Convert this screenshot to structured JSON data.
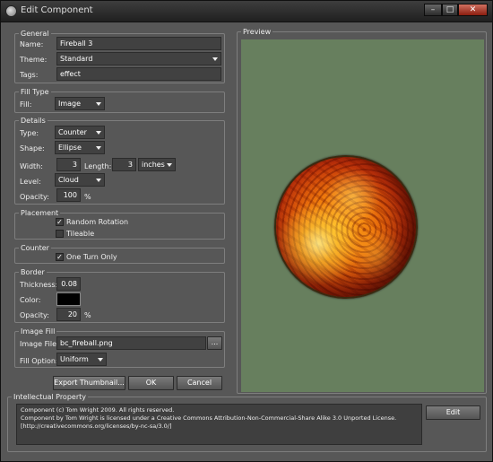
{
  "window": {
    "title": "Edit Component",
    "controls": {
      "minimize": "–",
      "maximize": "□",
      "close": "✕"
    }
  },
  "general": {
    "title": "General",
    "name_label": "Name:",
    "name_value": "Fireball 3",
    "theme_label": "Theme:",
    "theme_value": "Standard",
    "tags_label": "Tags:",
    "tags_value": "effect"
  },
  "fill_type": {
    "title": "Fill Type",
    "fill_label": "Fill:",
    "fill_value": "Image"
  },
  "details": {
    "title": "Details",
    "type_label": "Type:",
    "type_value": "Counter",
    "shape_label": "Shape:",
    "shape_value": "Ellipse",
    "width_label": "Width:",
    "width_value": "3",
    "length_label": "Length:",
    "length_value": "3",
    "unit_value": "inches",
    "level_label": "Level:",
    "level_value": "Cloud",
    "opacity_label": "Opacity:",
    "opacity_value": "100",
    "percent": "%"
  },
  "placement": {
    "title": "Placement",
    "random_rotation_label": "Random Rotation",
    "random_rotation_checked": true,
    "tileable_label": "Tileable",
    "tileable_checked": false
  },
  "counter": {
    "title": "Counter",
    "one_turn_label": "One Turn Only",
    "one_turn_checked": true
  },
  "border": {
    "title": "Border",
    "thickness_label": "Thickness:",
    "thickness_value": "0.08",
    "color_label": "Color:",
    "color_value": "#000000",
    "opacity_label": "Opacity:",
    "opacity_value": "20",
    "percent": "%"
  },
  "image_fill": {
    "title": "Image Fill",
    "file_label": "Image File:",
    "file_value": "bc_fireball.png",
    "browse_label": "...",
    "option_label": "Fill Option:",
    "option_value": "Uniform"
  },
  "buttons": {
    "export": "Export Thumbnail...",
    "ok": "OK",
    "cancel": "Cancel"
  },
  "preview": {
    "title": "Preview",
    "background_color": "#677f5e"
  },
  "ip": {
    "title": "Intellectual Property",
    "line1": "Component (c) Tom Wright 2009. All rights reserved.",
    "line2": "Component by Tom Wright is licensed under a Creative Commons Attribution-Non-Commercial-Share Alike 3.0 Unported License. [http://creativecommons.org/licenses/by-nc-sa/3.0/]",
    "edit_label": "Edit"
  }
}
